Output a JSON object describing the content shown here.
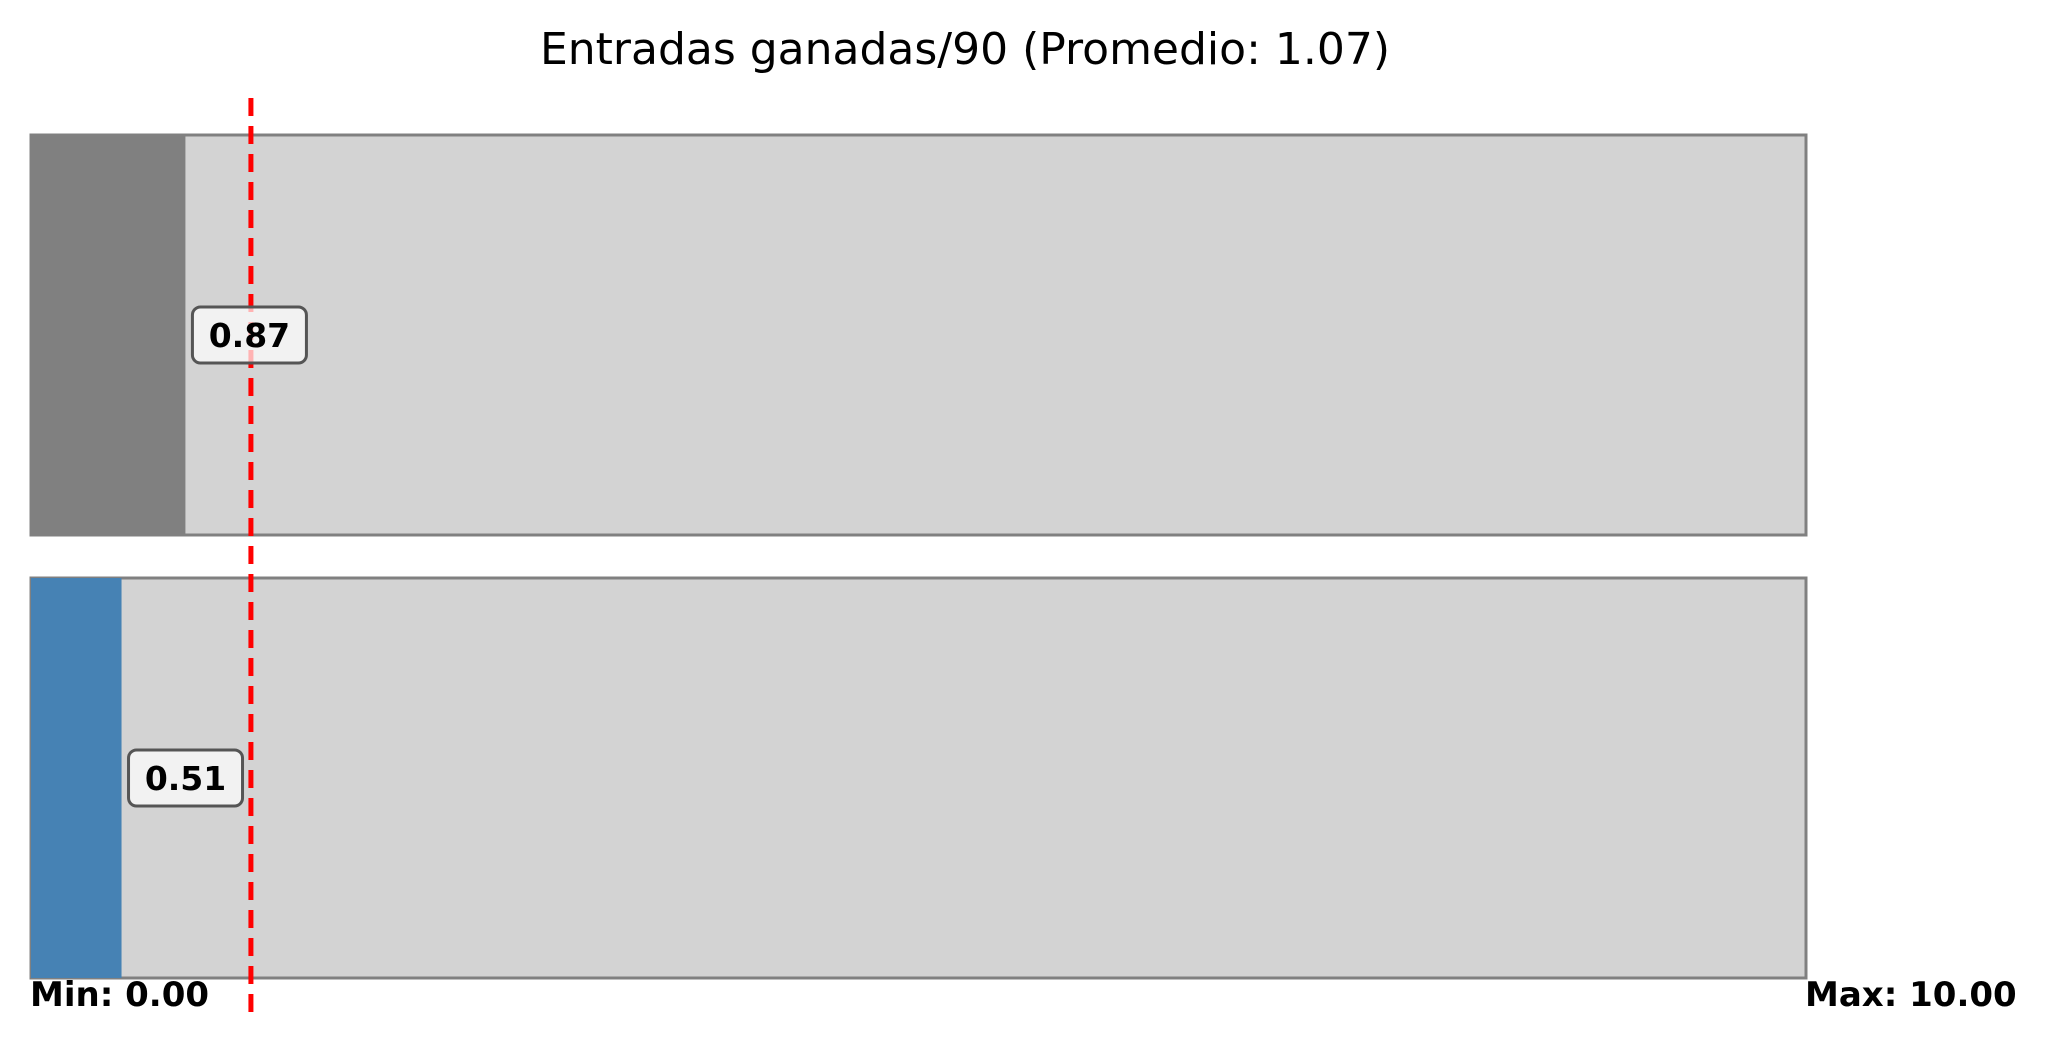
{
  "chart_data": {
    "type": "bar",
    "orientation": "horizontal",
    "title": "Entradas ganadas/90 (Promedio: 1.07)",
    "xlim": [
      0,
      10
    ],
    "min_label": "Min: 0.00",
    "max_label": "Max: 10.00",
    "reference_line": {
      "value": 1.07,
      "color": "#ff0000",
      "style": "dashed"
    },
    "bars": [
      {
        "value": 0.87,
        "label": "0.87",
        "color": "#808080"
      },
      {
        "value": 0.51,
        "label": "0.51",
        "color": "#4682b4"
      }
    ],
    "track_color": "#d3d3d3",
    "track_border_color": "#808080",
    "grid": false
  }
}
